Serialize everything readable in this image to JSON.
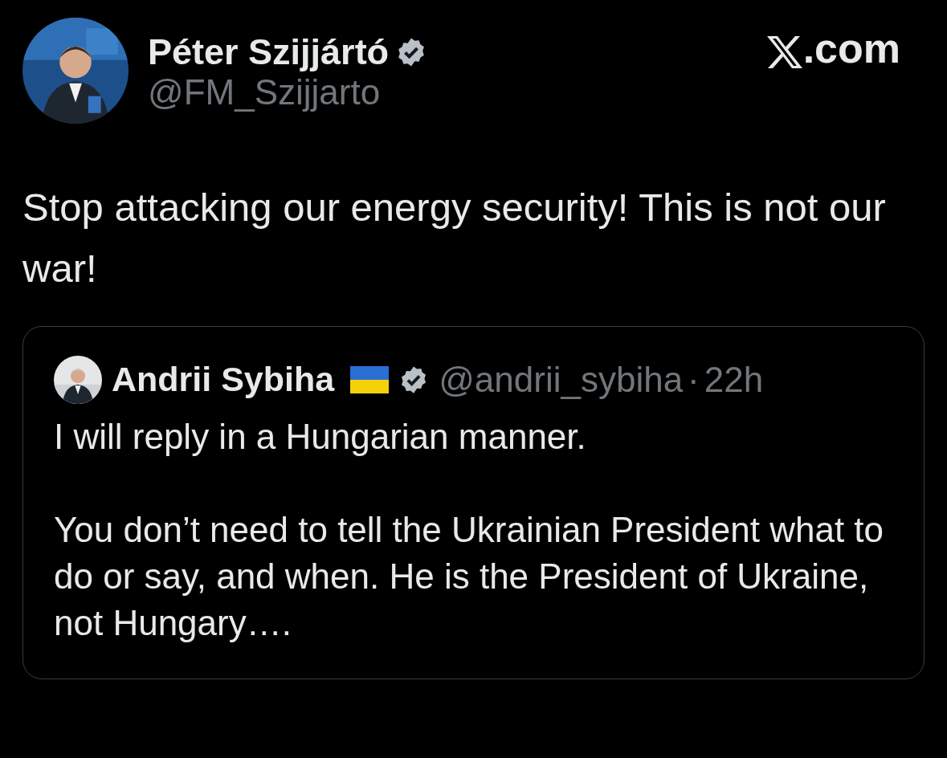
{
  "author": {
    "name": "Péter Szijjártó",
    "verified": true,
    "handle": "@FM_Szijjarto"
  },
  "brand": {
    "text": ".com"
  },
  "text": "Stop attacking our energy security! This is not our war!",
  "quote": {
    "author": {
      "name": "Andrii Sybiha",
      "verified": true,
      "handle": "@andrii_sybiha"
    },
    "separator": "·",
    "time": "22h",
    "paragraphs": [
      "I will reply in a Hungarian manner.",
      "You don’t need to tell the Ukrainian President what to do or say, and when. He is the President of Ukraine, not Hungary…."
    ]
  }
}
